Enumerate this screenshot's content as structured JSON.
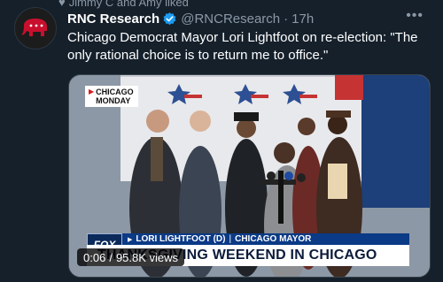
{
  "social_context": {
    "text": "Jimmy C and Amy liked"
  },
  "tweet": {
    "author_name": "RNC Research",
    "handle": "@RNCResearch",
    "separator": "·",
    "time": "17h",
    "more_icon": "more-horizontal-icon",
    "text": "Chicago Democrat Mayor Lori Lightfoot on re-election: \"The only rational choice is to return me to office.\""
  },
  "media": {
    "location_badge": {
      "line1": "CHICAGO",
      "line2": "MONDAY"
    },
    "network_logo": "FOX",
    "chyron": {
      "name": "LORI LIGHTFOOT (D)",
      "separator": "|",
      "title": "CHICAGO MAYOR",
      "headline": "THANKSGIVING WEEKEND IN CHICAGO"
    },
    "elapsed": "0:06",
    "divider": "/",
    "views": "95.8K views"
  },
  "colors": {
    "background": "#15202b",
    "secondary_text": "#8b98a5",
    "verified_blue": "#1d9bf0",
    "rnc_red": "#c8102e",
    "chyron_blue": "#0b3a86"
  }
}
